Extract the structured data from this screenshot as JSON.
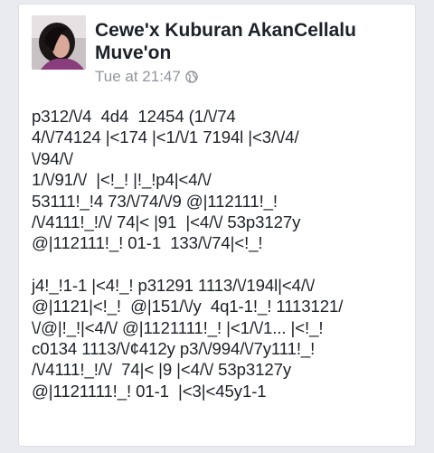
{
  "post": {
    "author": "Cewe'x Kuburan AkanCellalu Muve'on",
    "timestamp": "Tue at 21:47",
    "privacy_icon": "globe-icon",
    "paragraphs": [
      {
        "lines": [
          "p312/\\/4  4d4  12454 (1/\\/74",
          "4/\\/74124 |<174 |<1/\\/1 7194l |<3/\\/4/",
          "\\/94/\\/",
          "1/\\/91/\\/  |<!_! |!_!p4|<4/\\/",
          "53111!_!4 73/\\/74/\\/9 @|112111!_!",
          "/\\/4111!_!/\\/ 74|< |91  |<4/\\/ 53p3127y",
          "@|112111!_! 01-1  133/\\/74|<!_!"
        ]
      },
      {
        "lines": [
          "j4!_!1-1 |<4!_! p31291 1113/\\/194l|<4/\\/",
          "@|1121|<!_!  @|151/\\/y  4q1-1!_! 1113121/",
          "\\/@|!_!|<4/\\/ @|1121111!_! |<1/\\/1... |<!_!",
          "c0134 1113/\\/¢412y p3/\\/994/\\/7y111!_!",
          "/\\/4111!_!/\\/  74|< |9 |<4/\\/ 53p3127y",
          "@|1121111!_! 01-1  |<3|<45y1-1"
        ]
      }
    ]
  },
  "colors": {
    "background": "#e9ebee",
    "card": "#ffffff",
    "text": "#1d2129",
    "meta": "#90949c"
  }
}
